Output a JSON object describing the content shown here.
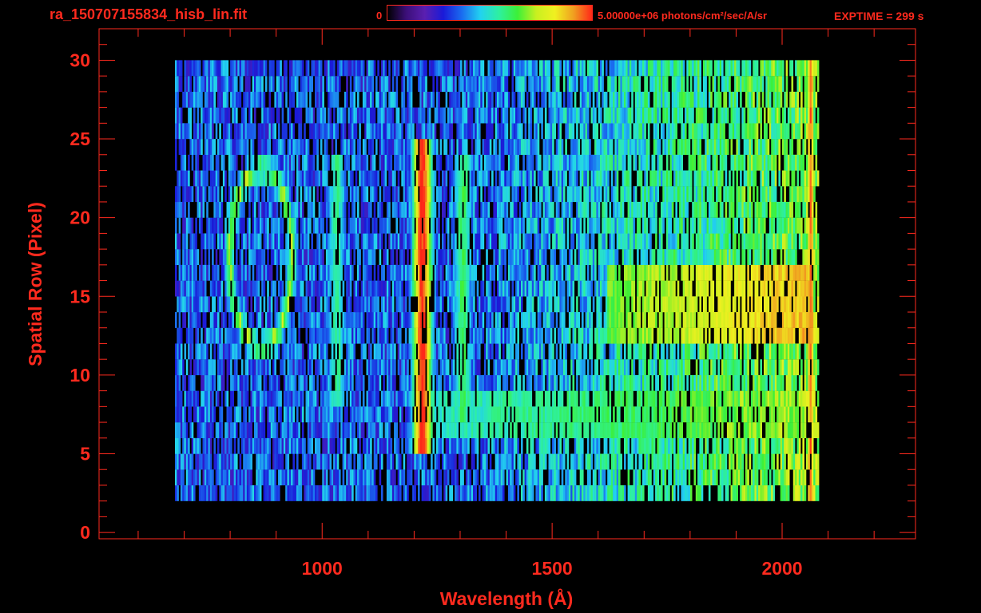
{
  "header": {
    "file_title": "ra_150707155834_hisb_lin.fit",
    "colorbar_min_label": "0",
    "colorbar_max_label": "5.00000e+06 photons/cm²/sec/A/sr",
    "exptime_label": "EXPTIME = 299 s"
  },
  "colors": {
    "axis": "#ff2a1e",
    "background": "#000000",
    "colormap": [
      "#000000",
      "#3b0f78",
      "#5a1fb0",
      "#1a1ad8",
      "#1a6cf0",
      "#22d2f0",
      "#2ef0a0",
      "#3cf038",
      "#c8f020",
      "#f0f020",
      "#f0a020",
      "#ff2818"
    ]
  },
  "chart_data": {
    "type": "heatmap",
    "title": "ra_150707155834_hisb_lin.fit",
    "xlabel": "Wavelength (Å)",
    "ylabel": "Spatial Row (Pixel)",
    "xlim": [
      515,
      2290
    ],
    "ylim": [
      -0.4,
      32
    ],
    "x_ticks": [
      1000,
      1500,
      2000
    ],
    "y_ticks": [
      0,
      5,
      10,
      15,
      20,
      25,
      30
    ],
    "colorbar": {
      "min": 0,
      "max": 5000000,
      "units": "photons/cm²/sec/A/sr"
    },
    "exptime_s": 299,
    "data_extent": {
      "wavelength_range": [
        680,
        2080
      ],
      "row_range": [
        2,
        30
      ]
    },
    "features": [
      {
        "name": "bright line",
        "wavelength": 1216,
        "rows": [
          5,
          24
        ],
        "peak_intensity_frac": 0.95
      },
      {
        "name": "line",
        "wavelength": 1304,
        "rows": [
          7,
          23
        ],
        "peak_intensity_frac": 0.55
      },
      {
        "name": "line",
        "wavelength": 1030,
        "rows": [
          8,
          23
        ],
        "peak_intensity_frac": 0.5
      },
      {
        "name": "continuum band",
        "wavelength_range": [
          1210,
          2065
        ],
        "rows": [
          5.5,
          8
        ],
        "peak_intensity_frac": 0.6
      },
      {
        "name": "continuum band",
        "wavelength_range": [
          1620,
          2065
        ],
        "rows": [
          12,
          16
        ],
        "peak_intensity_frac": 0.8
      },
      {
        "name": "ring feature",
        "center_wavelength": 865,
        "center_row": 17,
        "rows": [
          11,
          23
        ],
        "peak_intensity_frac": 0.65
      },
      {
        "name": "edge line",
        "wavelength": 2060,
        "rows": [
          2,
          30
        ],
        "peak_intensity_frac": 0.9
      }
    ]
  }
}
